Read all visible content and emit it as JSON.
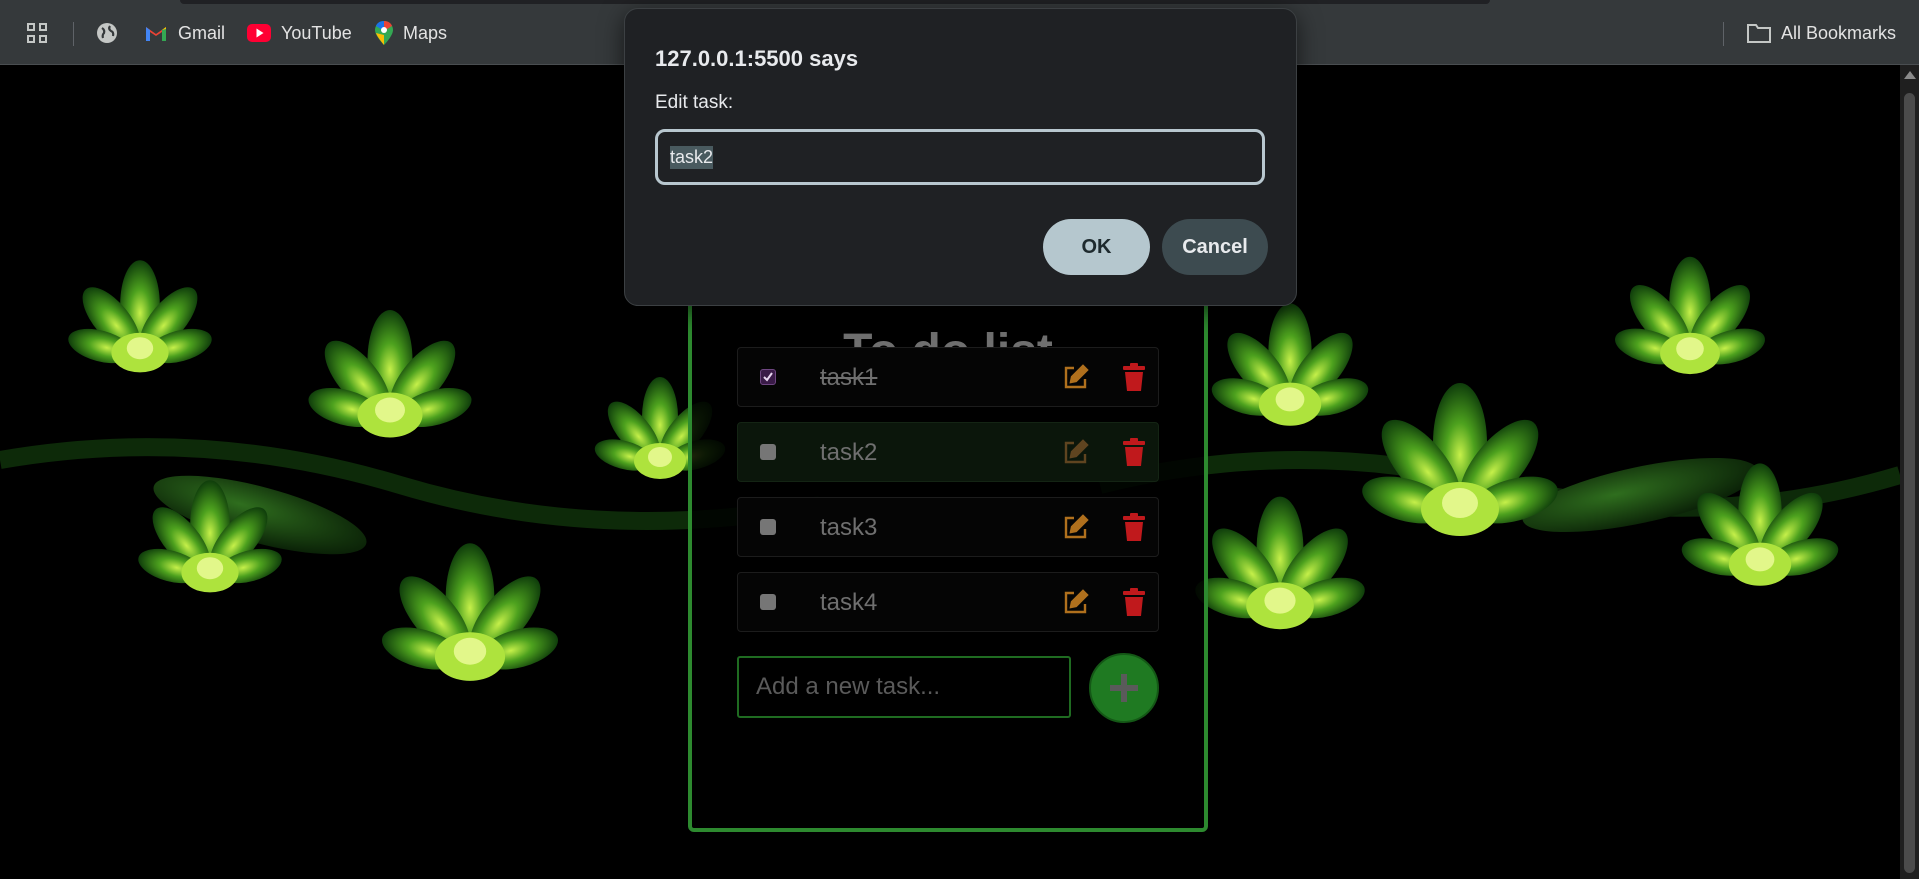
{
  "bookmarks_bar": {
    "items": [
      {
        "label": "Gmail",
        "icon": "gmail-icon"
      },
      {
        "label": "YouTube",
        "icon": "youtube-icon"
      },
      {
        "label": "Maps",
        "icon": "maps-icon"
      }
    ],
    "all_bookmarks_label": "All Bookmarks"
  },
  "todo": {
    "title": "To do list",
    "tasks": [
      {
        "text": "task1",
        "checked": true
      },
      {
        "text": "task2",
        "checked": false
      },
      {
        "text": "task3",
        "checked": false
      },
      {
        "text": "task4",
        "checked": false
      }
    ],
    "new_task_placeholder": "Add a new task...",
    "add_button_symbol": "+"
  },
  "dialog": {
    "title": "127.0.0.1:5500 says",
    "message": "Edit task:",
    "input_value": "task2",
    "ok_label": "OK",
    "cancel_label": "Cancel"
  },
  "colors": {
    "accent_green": "#2d8a2f",
    "edit_icon": "#b0701d",
    "delete_icon": "#c0191c",
    "dialog_ok": "#b5c7ce",
    "dialog_cancel": "#3d4b50"
  }
}
